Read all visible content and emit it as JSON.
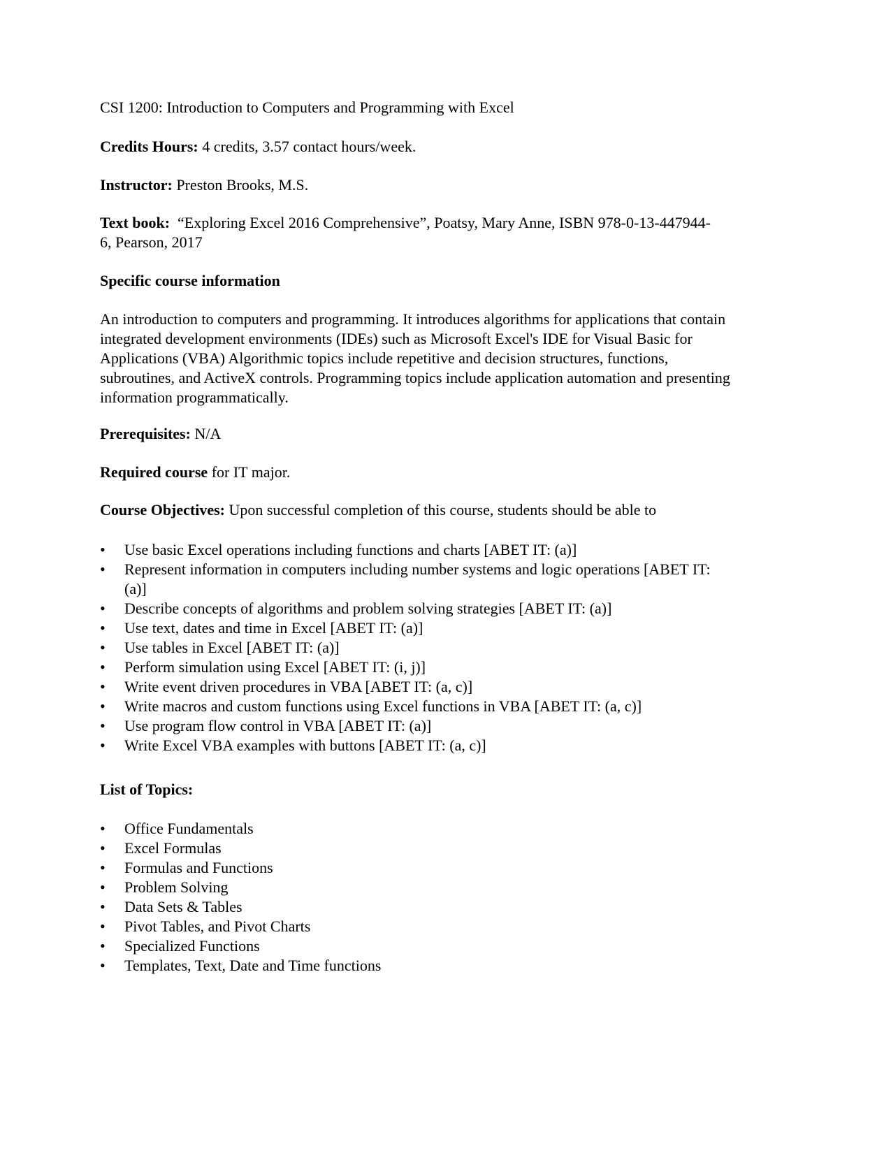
{
  "title": "CSI 1200: Introduction to Computers and Programming with Excel",
  "credits": {
    "label": "Credits Hours:",
    "value": " 4 credits, 3.57 contact hours/week."
  },
  "instructor": {
    "label": "Instructor:",
    "value": " Preston Brooks, M.S."
  },
  "textbook": {
    "label": "Text book:",
    "value": "  “Exploring Excel 2016 Comprehensive”, Poatsy, Mary Anne, ISBN 978-0-13-447944-6, Pearson, 2017"
  },
  "specific_info": {
    "heading": "Specific course information",
    "body": "An introduction to computers and programming. It introduces algorithms for applications that contain integrated development environments (IDEs) such as Microsoft Excel's IDE for Visual Basic for Applications (VBA) Algorithmic topics include repetitive and decision structures, functions, subroutines, and ActiveX controls. Programming topics include application automation and presenting information programmatically."
  },
  "prerequisites": {
    "label": "Prerequisites:",
    "value": " N/A"
  },
  "required": {
    "label": "Required course",
    "value": " for IT major."
  },
  "objectives": {
    "label": "Course Objectives:",
    "intro": " Upon successful completion of this course, students should be able to",
    "items": [
      "Use basic Excel operations including functions and charts [ABET IT: (a)]",
      "Represent information in computers including number systems and logic operations [ABET IT: (a)]",
      "Describe concepts of algorithms and problem solving strategies [ABET IT: (a)]",
      "Use text, dates and time in Excel [ABET IT: (a)]",
      "Use tables in Excel [ABET IT: (a)]",
      "Perform simulation using Excel [ABET IT: (i, j)]",
      "Write event driven procedures in VBA [ABET IT: (a, c)]",
      "Write macros and custom functions using Excel functions in VBA [ABET IT: (a, c)]",
      "Use program flow control in VBA [ABET IT: (a)]",
      "Write Excel VBA examples with buttons [ABET IT: (a, c)]"
    ]
  },
  "topics": {
    "heading": "List of Topics:",
    "items": [
      "Office Fundamentals",
      "Excel Formulas",
      "Formulas and Functions",
      "Problem Solving",
      "Data Sets & Tables",
      "Pivot Tables, and Pivot Charts",
      "Specialized Functions",
      "Templates, Text, Date and Time functions"
    ]
  },
  "bullet_glyph": "•"
}
